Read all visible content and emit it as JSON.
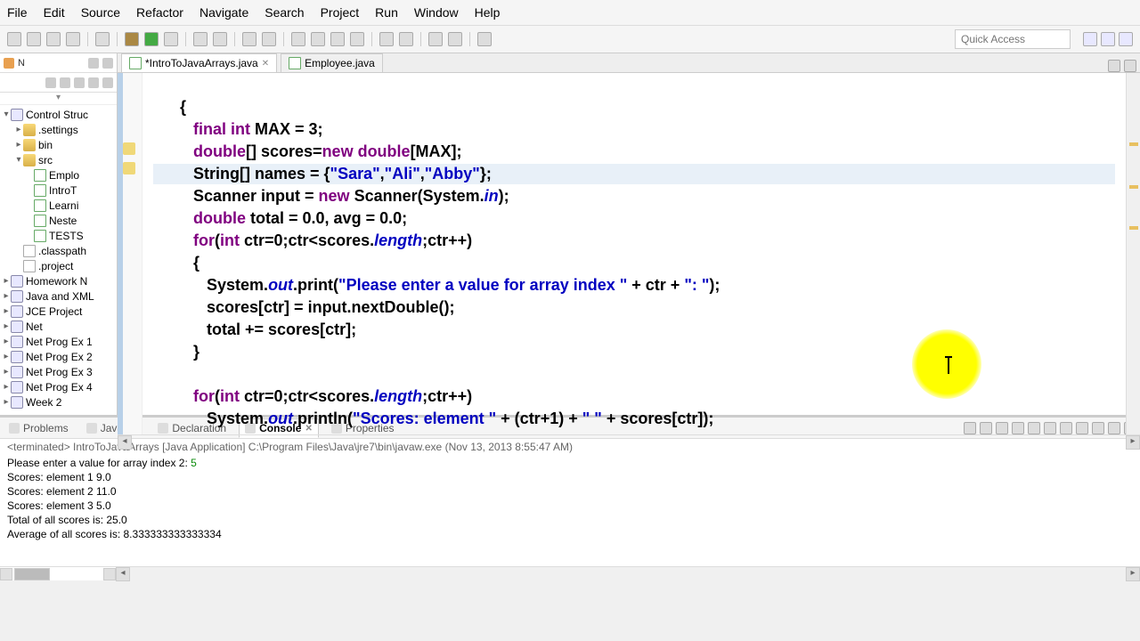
{
  "menu": [
    "File",
    "Edit",
    "Source",
    "Refactor",
    "Navigate",
    "Search",
    "Project",
    "Run",
    "Window",
    "Help"
  ],
  "quick_access_placeholder": "Quick Access",
  "sidebar": {
    "items": [
      {
        "label": "Control Struc",
        "indent": 0,
        "toggle": "▾",
        "icon": "proj-icon"
      },
      {
        "label": ".settings",
        "indent": 1,
        "toggle": "▸",
        "icon": "folder-icon"
      },
      {
        "label": "bin",
        "indent": 1,
        "toggle": "▸",
        "icon": "folder-icon"
      },
      {
        "label": "src",
        "indent": 1,
        "toggle": "▾",
        "icon": "folder-icon"
      },
      {
        "label": "Emplo",
        "indent": 2,
        "toggle": "",
        "icon": "java-icon"
      },
      {
        "label": "IntroT",
        "indent": 2,
        "toggle": "",
        "icon": "java-icon"
      },
      {
        "label": "Learni",
        "indent": 2,
        "toggle": "",
        "icon": "java-icon"
      },
      {
        "label": "Neste",
        "indent": 2,
        "toggle": "",
        "icon": "java-icon"
      },
      {
        "label": "TESTS",
        "indent": 2,
        "toggle": "",
        "icon": "java-icon"
      },
      {
        "label": ".classpath",
        "indent": 1,
        "toggle": "",
        "icon": "file-icon"
      },
      {
        "label": ".project",
        "indent": 1,
        "toggle": "",
        "icon": "file-icon"
      },
      {
        "label": "Homework N",
        "indent": 0,
        "toggle": "▸",
        "icon": "proj-icon"
      },
      {
        "label": "Java and XML",
        "indent": 0,
        "toggle": "▸",
        "icon": "proj-icon"
      },
      {
        "label": "JCE Project",
        "indent": 0,
        "toggle": "▸",
        "icon": "proj-icon"
      },
      {
        "label": "Net",
        "indent": 0,
        "toggle": "▸",
        "icon": "proj-icon"
      },
      {
        "label": "Net Prog Ex 1",
        "indent": 0,
        "toggle": "▸",
        "icon": "proj-icon"
      },
      {
        "label": "Net Prog Ex 2",
        "indent": 0,
        "toggle": "▸",
        "icon": "proj-icon"
      },
      {
        "label": "Net Prog Ex 3",
        "indent": 0,
        "toggle": "▸",
        "icon": "proj-icon"
      },
      {
        "label": "Net Prog Ex 4",
        "indent": 0,
        "toggle": "▸",
        "icon": "proj-icon"
      },
      {
        "label": "Week 2",
        "indent": 0,
        "toggle": "▸",
        "icon": "proj-icon"
      }
    ]
  },
  "tabs": {
    "active": "*IntroToJavaArrays.java",
    "inactive": "Employee.java"
  },
  "code": {
    "l1": "      {",
    "l2a": "         final int",
    "l2b": " MAX = 3;",
    "l3a": "         double",
    "l3b": "[] scores=",
    "l3c": "new double",
    "l3d": "[MAX];",
    "l4a": "         String[] names = {",
    "l4b": "\"Sara\"",
    "l4c": ",",
    "l4d": "\"Ali\"",
    "l4e": ",",
    "l4f": "\"Abby\"",
    "l4g": "};",
    "l5a": "         Scanner input = ",
    "l5b": "new",
    "l5c": " Scanner(System.",
    "l5d": "in",
    "l5e": ");",
    "l6a": "         double",
    "l6b": " total = 0.0, avg = 0.0;",
    "l7a": "         for",
    "l7b": "(",
    "l7c": "int",
    "l7d": " ctr=0;ctr<scores.",
    "l7e": "length",
    "l7f": ";ctr++)",
    "l8": "         {",
    "l9a": "            System.",
    "l9b": "out",
    "l9c": ".print(",
    "l9d": "\"Please enter a value for array index \"",
    "l9e": " + ctr + ",
    "l9f": "\": \"",
    "l9g": ");",
    "l10": "            scores[ctr] = input.nextDouble();",
    "l11": "            total += scores[ctr];",
    "l12": "         }",
    "l13": "",
    "l14a": "         for",
    "l14b": "(",
    "l14c": "int",
    "l14d": " ctr=0;ctr<scores.",
    "l14e": "length",
    "l14f": ";ctr++)",
    "l15a": "            System.",
    "l15b": "out",
    "l15c": ".println(",
    "l15d": "\"Scores: element \"",
    "l15e": " + (ctr+1) + ",
    "l15f": "\" \"",
    "l15g": " + scores[ctr]);"
  },
  "bottom_tabs": [
    "Problems",
    "Javadoc",
    "Declaration",
    "Console",
    "Properties"
  ],
  "console": {
    "header": "<terminated> IntroToJavaArrays [Java Application] C:\\Program Files\\Java\\jre7\\bin\\javaw.exe (Nov 13, 2013 8:55:47 AM)",
    "line1a": "Please enter a value for array index 2: ",
    "line1b": "5",
    "line2": "Scores: element 1 9.0",
    "line3": "Scores: element 2 11.0",
    "line4": "Scores: element 3 5.0",
    "line5": "Total of all scores is: 25.0",
    "line6": "Average of all scores is: 8.333333333333334"
  }
}
